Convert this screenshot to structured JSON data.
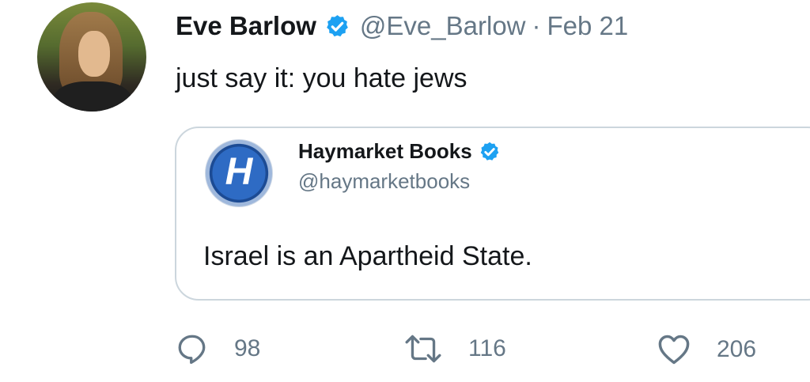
{
  "tweet": {
    "author_name": "Eve Barlow",
    "handle": "@Eve_Barlow",
    "separator": "·",
    "date": "Feb 21",
    "text": "just say it: you hate jews",
    "verified": true
  },
  "quoted_tweet": {
    "author_name": "Haymarket Books",
    "handle": "@haymarketbooks",
    "avatar_letter": "H",
    "text": "Israel is an Apartheid State.",
    "verified": true
  },
  "actions": {
    "reply_count": "98",
    "retweet_count": "116",
    "like_count": "206"
  },
  "colors": {
    "verified_blue": "#1da1f2",
    "secondary_text": "#657786",
    "border": "#ccd6dd"
  },
  "icons": {
    "verified": "verified-badge-icon",
    "reply": "reply-icon",
    "retweet": "retweet-icon",
    "like": "heart-icon"
  }
}
